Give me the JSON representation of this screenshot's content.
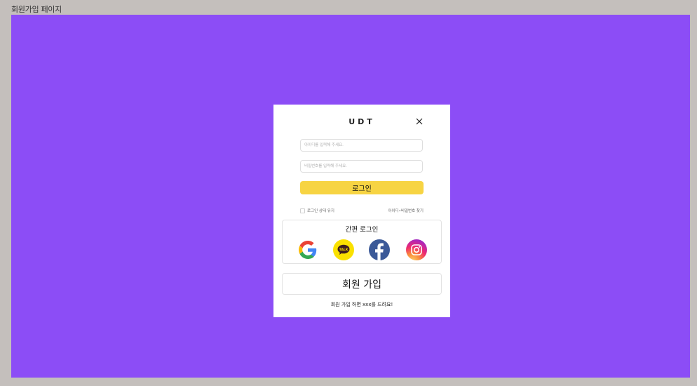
{
  "page": {
    "label": "회원가입 페이지"
  },
  "colors": {
    "frame_bg": "#8c4df6",
    "accent": "#f7d443"
  },
  "modal": {
    "brand": "UDT",
    "close_icon": "close-icon",
    "id_placeholder": "아이디를 입력해 주세요.",
    "pw_placeholder": "비밀번호를 입력해 주세요.",
    "login_label": "로그인",
    "keep_login_label": "로그인 상태 유지",
    "find_label": "아이디•비밀번호 찾기",
    "easy_login": {
      "title": "간편 로그인",
      "providers": [
        "google-icon",
        "kakao-icon",
        "facebook-icon",
        "instagram-icon"
      ],
      "kakao_text": "TALK"
    },
    "signup_label": "회원 가입",
    "promo_text": "회원 가입 하면 xxx를 드려요!"
  }
}
